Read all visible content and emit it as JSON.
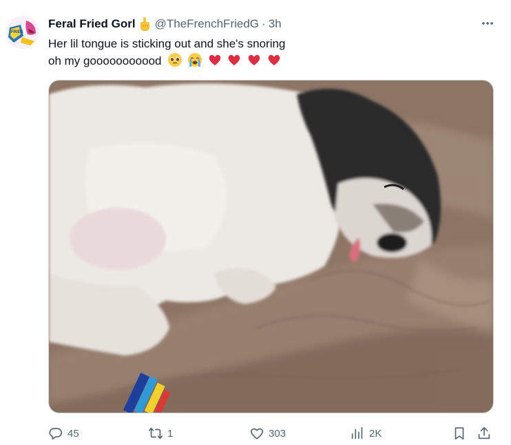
{
  "tweet": {
    "author_name": "Feral Fried Gorl",
    "handle": "@TheFrenchFriedG",
    "separator": "·",
    "time": "3h",
    "text_line1": "Her lil tongue is sticking out and she's snoring",
    "text_line2": "oh my gooooooooood",
    "emojis": [
      "pleading-face-emoji",
      "loudly-crying-face-emoji",
      "red-heart-emoji",
      "red-heart-emoji",
      "red-heart-emoji",
      "red-heart-emoji"
    ]
  },
  "media": {
    "subject": "sleeping-puppy-photo"
  },
  "actions": {
    "replies": "45",
    "reposts": "1",
    "likes": "303",
    "views": "2K"
  },
  "colors": {
    "text": "#0f1419",
    "secondary": "#536471",
    "border": "#cfd9de",
    "heart": "#f91880"
  }
}
